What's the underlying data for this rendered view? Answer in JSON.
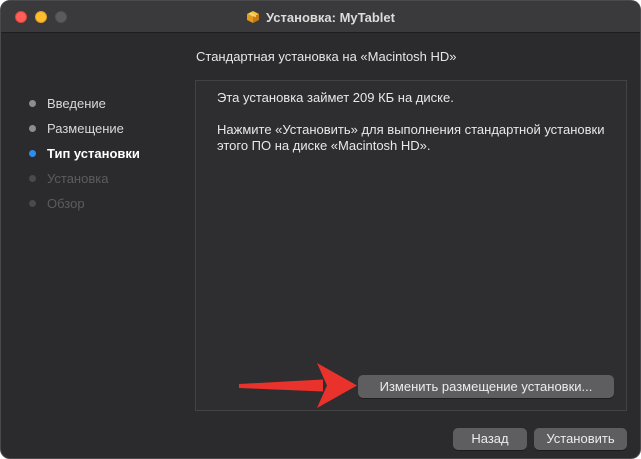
{
  "window": {
    "title": "Установка: MyTablet",
    "icon": "package-icon"
  },
  "header": {
    "subtitle": "Стандартная установка на «Macintosh HD»"
  },
  "sidebar": {
    "steps": [
      {
        "label": "Введение",
        "state": "done"
      },
      {
        "label": "Размещение",
        "state": "done"
      },
      {
        "label": "Тип установки",
        "state": "active"
      },
      {
        "label": "Установка",
        "state": "pending"
      },
      {
        "label": "Обзор",
        "state": "pending"
      }
    ]
  },
  "main": {
    "line1": "Эта установка займет 209 КБ на диске.",
    "line2": "Нажмите «Установить» для выполнения стандартной установки этого ПО на диске «Macintosh HD».",
    "change_location_label": "Изменить размещение установки..."
  },
  "footer": {
    "back_label": "Назад",
    "install_label": "Установить"
  },
  "colors": {
    "accent": "#2d8cf0",
    "arrow": "#e8322b",
    "close": "#fe5f57",
    "minimize": "#febc2e"
  }
}
